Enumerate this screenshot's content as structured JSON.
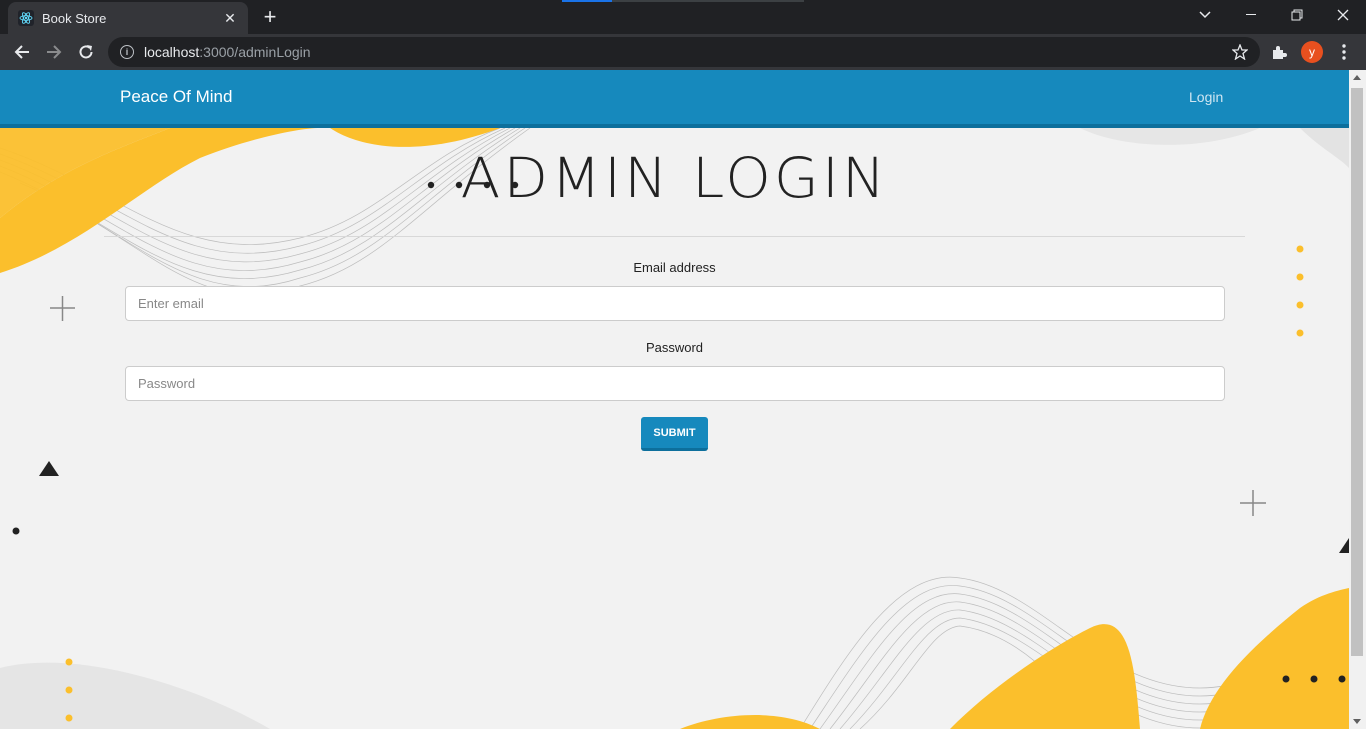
{
  "browser": {
    "tab_title": "Book Store",
    "url_host": "localhost",
    "url_path": ":3000/adminLogin",
    "avatar_letter": "y"
  },
  "navbar": {
    "brand": "Peace Of Mind",
    "login_link": "Login"
  },
  "form": {
    "heading": "ADMIN LOGIN",
    "email_label": "Email address",
    "email_placeholder": "Enter email",
    "password_label": "Password",
    "password_placeholder": "Password",
    "submit_label": "SUBMIT"
  },
  "colors": {
    "navbar": "#1689bd",
    "accent_yellow": "#fbbf2c",
    "page_bg": "#f2f2f2"
  }
}
